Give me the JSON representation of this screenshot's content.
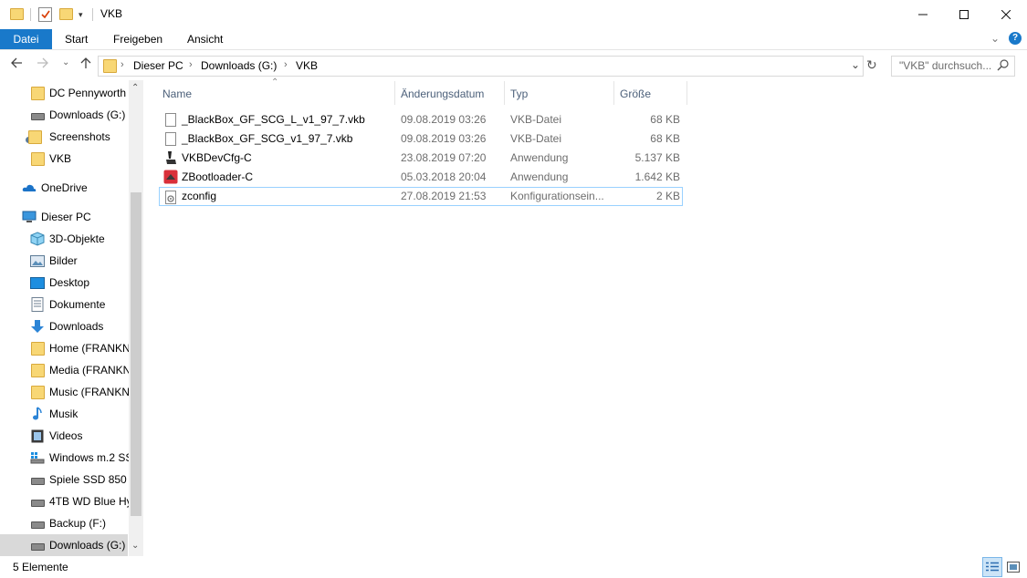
{
  "window": {
    "title": "VKB"
  },
  "ribbon": {
    "tabs": [
      "Datei",
      "Start",
      "Freigeben",
      "Ansicht"
    ]
  },
  "address": {
    "crumbs": [
      "Dieser PC",
      "Downloads (G:)",
      "VKB"
    ],
    "search_placeholder": "\"VKB\" durchsuch..."
  },
  "nav": {
    "items": [
      {
        "label": "DC Pennyworth",
        "icon": "folder-icon"
      },
      {
        "label": "Downloads (G:)",
        "icon": "drive-icon"
      },
      {
        "label": "Screenshots",
        "icon": "folder-icon"
      },
      {
        "label": "VKB",
        "icon": "folder-icon"
      },
      {
        "label": "OneDrive",
        "icon": "onedrive-icon"
      },
      {
        "label": "Dieser PC",
        "icon": "pc-icon"
      },
      {
        "label": "3D-Objekte",
        "icon": "3d-objects-icon"
      },
      {
        "label": "Bilder",
        "icon": "pictures-icon"
      },
      {
        "label": "Desktop",
        "icon": "desktop-icon"
      },
      {
        "label": "Dokumente",
        "icon": "documents-icon"
      },
      {
        "label": "Downloads",
        "icon": "downloads-icon"
      },
      {
        "label": "Home (FRANKN",
        "icon": "network-folder-icon"
      },
      {
        "label": "Media (FRANKN",
        "icon": "network-folder-icon"
      },
      {
        "label": "Music (FRANKN",
        "icon": "network-folder-icon"
      },
      {
        "label": "Musik",
        "icon": "music-icon"
      },
      {
        "label": "Videos",
        "icon": "videos-icon"
      },
      {
        "label": "Windows m.2 SS",
        "icon": "windows-drive-icon"
      },
      {
        "label": "Spiele SSD 850 P",
        "icon": "drive-icon"
      },
      {
        "label": "4TB WD Blue Hy",
        "icon": "drive-icon"
      },
      {
        "label": "Backup (F:)",
        "icon": "drive-icon"
      },
      {
        "label": "Downloads (G:)",
        "icon": "drive-icon"
      }
    ],
    "selected": "Downloads (G:)"
  },
  "columns": {
    "name": "Name",
    "date": "Änderungsdatum",
    "type": "Typ",
    "size": "Größe"
  },
  "files": [
    {
      "name": "_BlackBox_GF_SCG_L_v1_97_7.vkb",
      "date": "09.08.2019 03:26",
      "type": "VKB-Datei",
      "size": "68 KB",
      "icon": "file-icon"
    },
    {
      "name": "_BlackBox_GF_SCG_v1_97_7.vkb",
      "date": "09.08.2019 03:26",
      "type": "VKB-Datei",
      "size": "68 KB",
      "icon": "file-icon"
    },
    {
      "name": "VKBDevCfg-C",
      "date": "23.08.2019 07:20",
      "type": "Anwendung",
      "size": "5.137 KB",
      "icon": "joystick-icon"
    },
    {
      "name": "ZBootloader-C",
      "date": "05.03.2018 20:04",
      "type": "Anwendung",
      "size": "1.642 KB",
      "icon": "bootloader-icon"
    },
    {
      "name": "zconfig",
      "date": "27.08.2019 21:53",
      "type": "Konfigurationsein...",
      "size": "2 KB",
      "icon": "config-file-icon"
    }
  ],
  "status": {
    "count": "5 Elemente"
  },
  "colors": {
    "accent": "#1979ca",
    "header_text": "#4c607a"
  }
}
